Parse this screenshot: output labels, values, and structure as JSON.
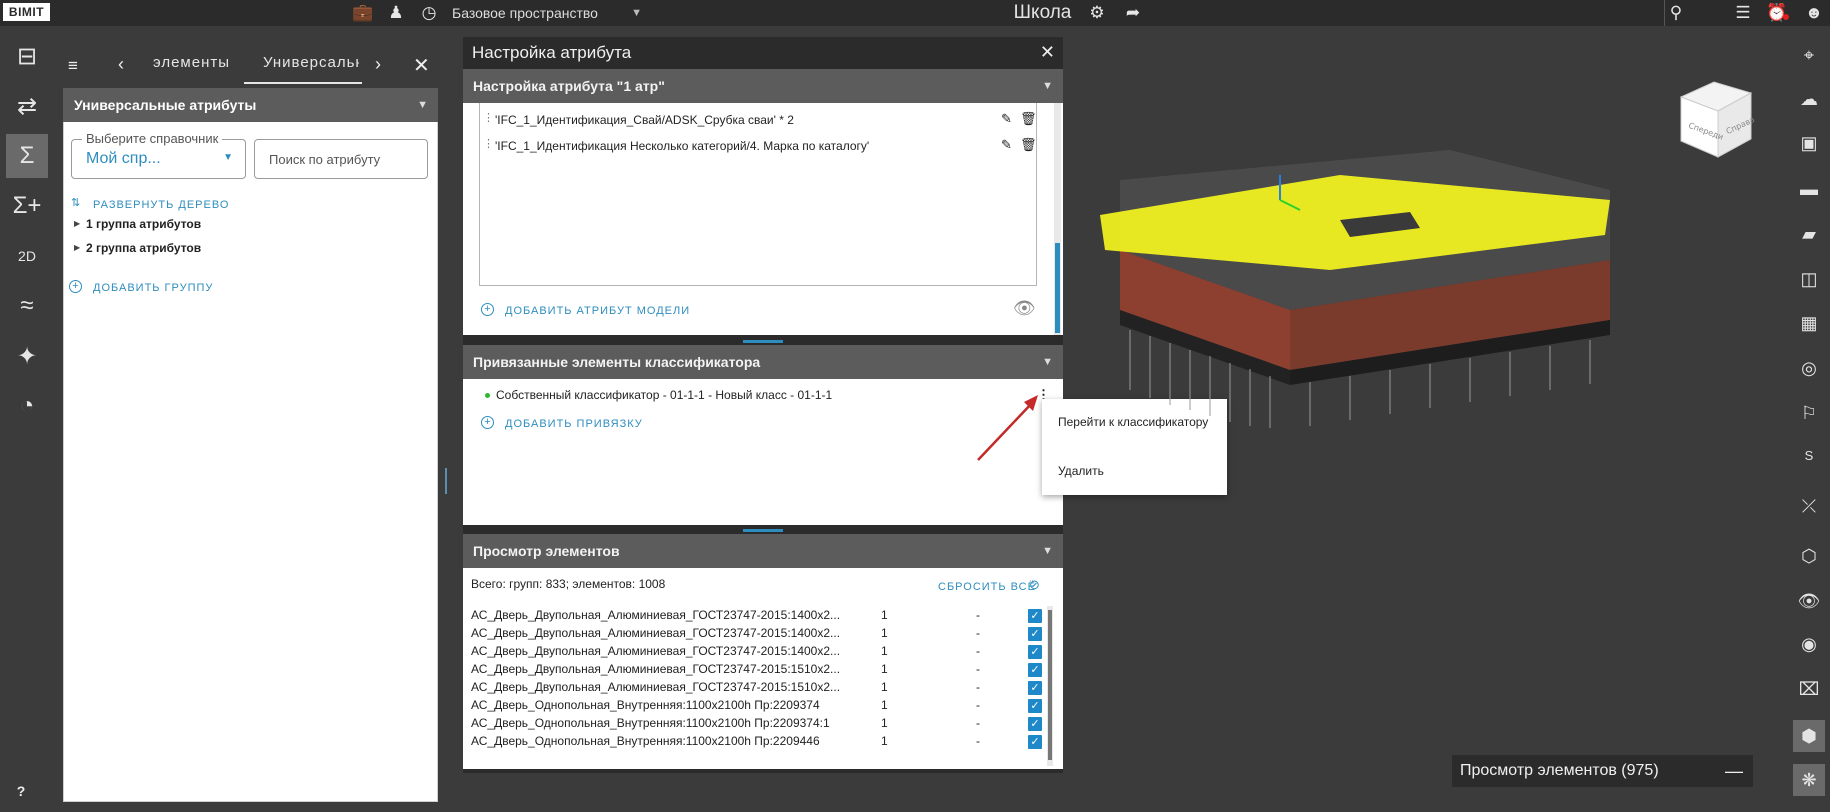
{
  "topbar": {
    "logo": "BIMIT",
    "space_label": "Базовое пространство",
    "project_title": "Школа"
  },
  "left_panel": {
    "tabs": [
      "элементы",
      "Универсальн"
    ],
    "section_title": "Универсальные атрибуты",
    "handbook_legend": "Выберите справочник",
    "handbook_value": "Мой спр...",
    "search_placeholder": "Поиск по атрибуту",
    "expand_tree": "РАЗВЕРНУТЬ ДЕРЕВО",
    "groups": [
      "1 группа атрибутов",
      "2 группа атрибутов"
    ],
    "add_group": "ДОБАВИТЬ ГРУППУ"
  },
  "attr_window": {
    "title": "Настройка атрибута",
    "section1_title": "Настройка атрибута \"1 атр\"",
    "attributes": [
      "'IFC_1_Идентификация_Свай/ADSK_Срубка сваи' * 2",
      "'IFC_1_Идентификация Несколько категорий/4. Марка по каталогу'"
    ],
    "add_model_attr": "ДОБАВИТЬ АТРИБУТ МОДЕЛИ",
    "section2_title": "Привязанные элементы классификатора",
    "classifier_item": "Собственный классификатор - 01-1-1 - Новый класс - 01-1-1",
    "add_binding": "ДОБАВИТЬ ПРИВЯЗКУ",
    "section3_title": "Просмотр элементов",
    "summary": "Всего: групп: 833; элементов: 1008",
    "reset_all": "СБРОСИТЬ ВСЁ",
    "rows": [
      {
        "name": "АС_Дверь_Двупольная_Алюминиевая_ГОСТ23747-2015:1400х2...",
        "count": "1",
        "val": "-"
      },
      {
        "name": "АС_Дверь_Двупольная_Алюминиевая_ГОСТ23747-2015:1400х2...",
        "count": "1",
        "val": "-"
      },
      {
        "name": "АС_Дверь_Двупольная_Алюминиевая_ГОСТ23747-2015:1400х2...",
        "count": "1",
        "val": "-"
      },
      {
        "name": "АС_Дверь_Двупольная_Алюминиевая_ГОСТ23747-2015:1510х2...",
        "count": "1",
        "val": "-"
      },
      {
        "name": "АС_Дверь_Двупольная_Алюминиевая_ГОСТ23747-2015:1510х2...",
        "count": "1",
        "val": "-"
      },
      {
        "name": "АС_Дверь_Однопольная_Внутренняя:1100x2100h Пр:2209374",
        "count": "1",
        "val": "-"
      },
      {
        "name": "АС_Дверь_Однопольная_Внутренняя:1100x2100h Пр:2209374:1",
        "count": "1",
        "val": "-"
      },
      {
        "name": "АС_Дверь_Однопольная_Внутренняя:1100x2100h Пр:2209446",
        "count": "1",
        "val": "-"
      }
    ]
  },
  "context_menu": {
    "items": [
      "Перейти к классификатору",
      "Удалить"
    ]
  },
  "navcube": {
    "front": "Спереди",
    "right": "Справа"
  },
  "bottom_panel": {
    "title": "Просмотр элементов (975)"
  },
  "colors": {
    "accent": "#1e88c8",
    "highlight": "#f5f51e",
    "status_green": "#2db82d"
  }
}
